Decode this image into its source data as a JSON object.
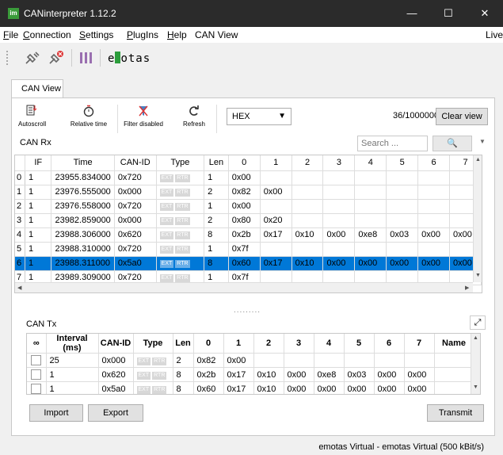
{
  "window": {
    "app_icon": "im",
    "title": "CANinterpreter 1.12.2",
    "minimize_glyph": "—",
    "maximize_glyph": "☐",
    "close_glyph": "✕"
  },
  "menu": [
    {
      "label": "File",
      "u": "F",
      "rest": "ile"
    },
    {
      "label": "Connection",
      "u": "C",
      "rest": "onnection"
    },
    {
      "label": "Settings",
      "u": "S",
      "rest": "ettings"
    },
    {
      "label": "PlugIns",
      "u": "P",
      "rest": "lugIns"
    },
    {
      "label": "Help",
      "u": "H",
      "rest": "elp"
    },
    {
      "label": "CAN View",
      "u": "",
      "rest": "CAN View"
    },
    {
      "label": "Live",
      "u": "",
      "rest": "Live"
    }
  ],
  "toolbar": {
    "icons": [
      "connect-icon",
      "disconnect-icon",
      "can-view-icon"
    ],
    "logo_left": "e",
    "logo_right": "otas"
  },
  "tabs": {
    "can_view": "CAN View"
  },
  "actions": {
    "autoscroll": "Autoscroll",
    "relative_time": "Relative time",
    "filter_disabled": "Filter disabled",
    "refresh": "Refresh",
    "format": "HEX",
    "counter": "36/1000000",
    "clear_view": "Clear view"
  },
  "rx": {
    "label": "CAN Rx",
    "search_placeholder": "Search ...",
    "search_icon": "🔍",
    "columns": [
      "IF",
      "Time",
      "CAN-ID",
      "Type",
      "Len",
      "0",
      "1",
      "2",
      "3",
      "4",
      "5",
      "6",
      "7"
    ],
    "flags": [
      "EXT",
      "RTR"
    ],
    "rows": [
      {
        "idx": "0",
        "if": "1",
        "time": "23955.834000",
        "id": "0x720",
        "len": "1",
        "bytes": [
          "0x00",
          "",
          "",
          "",
          "",
          "",
          "",
          ""
        ]
      },
      {
        "idx": "1",
        "if": "1",
        "time": "23976.555000",
        "id": "0x000",
        "len": "2",
        "bytes": [
          "0x82",
          "0x00",
          "",
          "",
          "",
          "",
          "",
          ""
        ]
      },
      {
        "idx": "2",
        "if": "1",
        "time": "23976.558000",
        "id": "0x720",
        "len": "1",
        "bytes": [
          "0x00",
          "",
          "",
          "",
          "",
          "",
          "",
          ""
        ]
      },
      {
        "idx": "3",
        "if": "1",
        "time": "23982.859000",
        "id": "0x000",
        "len": "2",
        "bytes": [
          "0x80",
          "0x20",
          "",
          "",
          "",
          "",
          "",
          ""
        ]
      },
      {
        "idx": "4",
        "if": "1",
        "time": "23988.306000",
        "id": "0x620",
        "len": "8",
        "bytes": [
          "0x2b",
          "0x17",
          "0x10",
          "0x00",
          "0xe8",
          "0x03",
          "0x00",
          "0x00"
        ]
      },
      {
        "idx": "5",
        "if": "1",
        "time": "23988.310000",
        "id": "0x720",
        "len": "1",
        "bytes": [
          "0x7f",
          "",
          "",
          "",
          "",
          "",
          "",
          ""
        ]
      },
      {
        "idx": "6",
        "if": "1",
        "time": "23988.311000",
        "id": "0x5a0",
        "len": "8",
        "bytes": [
          "0x60",
          "0x17",
          "0x10",
          "0x00",
          "0x00",
          "0x00",
          "0x00",
          "0x00"
        ],
        "selected": true
      },
      {
        "idx": "7",
        "if": "1",
        "time": "23989.309000",
        "id": "0x720",
        "len": "1",
        "bytes": [
          "0x7f",
          "",
          "",
          "",
          "",
          "",
          "",
          ""
        ]
      }
    ]
  },
  "tx": {
    "label": "CAN Tx",
    "expand_glyph": "⤢",
    "columns": [
      "∞",
      "Interval (ms)",
      "CAN-ID",
      "Type",
      "Len",
      "0",
      "1",
      "2",
      "3",
      "4",
      "5",
      "6",
      "7",
      "Name"
    ],
    "flags": [
      "EXT",
      "RTR"
    ],
    "rows": [
      {
        "interval": "25",
        "id": "0x000",
        "len": "2",
        "bytes": [
          "0x82",
          "0x00",
          "",
          "",
          "",
          "",
          "",
          ""
        ],
        "name": ""
      },
      {
        "interval": "1",
        "id": "0x620",
        "len": "8",
        "bytes": [
          "0x2b",
          "0x17",
          "0x10",
          "0x00",
          "0xe8",
          "0x03",
          "0x00",
          "0x00"
        ],
        "name": ""
      },
      {
        "interval": "1",
        "id": "0x5a0",
        "len": "8",
        "bytes": [
          "0x60",
          "0x17",
          "0x10",
          "0x00",
          "0x00",
          "0x00",
          "0x00",
          "0x00"
        ],
        "name": ""
      }
    ],
    "import": "Import",
    "export": "Export",
    "transmit": "Transmit"
  },
  "status": "emotas Virtual - emotas Virtual (500 kBit/s)",
  "colors": {
    "titlebar": "#2b2b2b",
    "selection": "#0078d7",
    "brand_green": "#2c9d3c"
  }
}
